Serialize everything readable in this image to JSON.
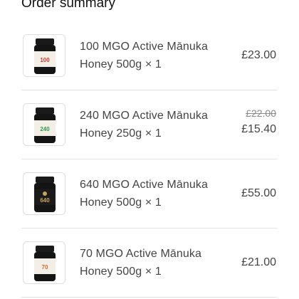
{
  "summary_title": "Order summary",
  "items": [
    {
      "name": "100 MGO Active Mānuka Honey 500g × 1",
      "price": "£23.00",
      "jar_label": "100",
      "jar_label_color": "#d33a2c",
      "jar_band_color": "#f3efe6",
      "jar_style": "light",
      "thumbnail_icon": "honey-jar-icon"
    },
    {
      "name": "240 MGO Active Mānuka Honey 250g × 1",
      "original_price": "£22.00",
      "price": "£15.40",
      "jar_label": "240",
      "jar_label_color": "#2d9b4a",
      "jar_band_color": "#f3efe6",
      "jar_style": "light",
      "thumbnail_icon": "honey-jar-icon"
    },
    {
      "name": "640 MGO Active Mānuka Honey 500g × 1",
      "price": "£55.00",
      "jar_label": "640",
      "jar_label_color": "#c9a45a",
      "jar_band_color": "#1b1b1b",
      "jar_style": "dark",
      "thumbnail_icon": "honey-jar-icon"
    },
    {
      "name": "70 MGO Active Mānuka Honey 500g × 1",
      "price": "£21.00",
      "jar_label": "70",
      "jar_label_color": "#e26a2c",
      "jar_band_color": "#f3efe6",
      "jar_style": "light",
      "thumbnail_icon": "honey-jar-icon"
    }
  ]
}
